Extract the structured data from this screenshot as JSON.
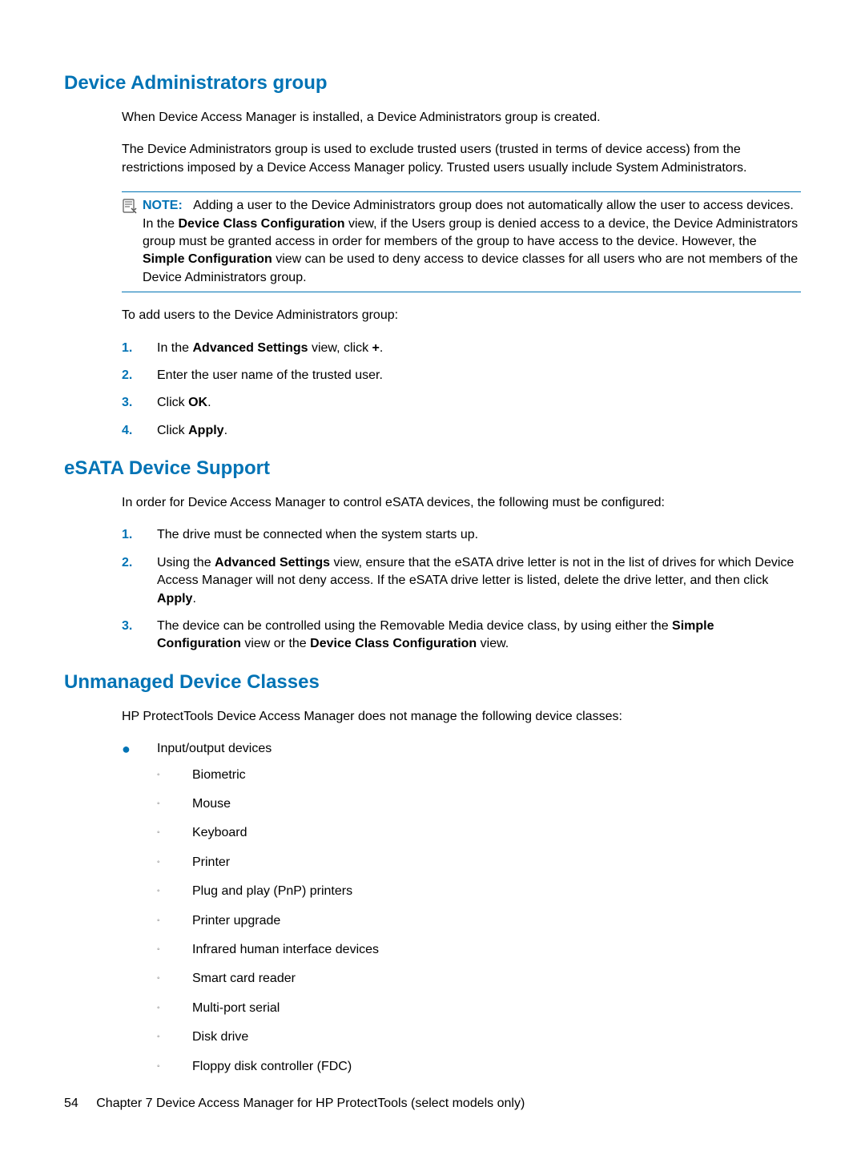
{
  "section1": {
    "heading": "Device Administrators group",
    "p1": "When Device Access Manager is installed, a Device Administrators group is created.",
    "p2": "The Device Administrators group is used to exclude trusted users (trusted in terms of device access) from the restrictions imposed by a Device Access Manager policy. Trusted users usually include System Administrators.",
    "note": {
      "label": "NOTE:",
      "t1": "Adding a user to the Device Administrators group does not automatically allow the user to access devices. In the ",
      "b1": "Device Class Configuration",
      "t2": " view, if the Users group is denied access to a device, the Device Administrators group must be granted access in order for members of the group to have access to the device. However, the ",
      "b2": "Simple Configuration",
      "t3": " view can be used to deny access to device classes for all users who are not members of the Device Administrators group."
    },
    "p3": "To add users to the Device Administrators group:",
    "steps": [
      {
        "num": "1.",
        "pre": "In the ",
        "b1": "Advanced Settings",
        "mid": " view, click ",
        "b2": "+",
        "post": "."
      },
      {
        "num": "2.",
        "text": "Enter the user name of the trusted user."
      },
      {
        "num": "3.",
        "pre": "Click ",
        "b1": "OK",
        "post": "."
      },
      {
        "num": "4.",
        "pre": "Click ",
        "b1": "Apply",
        "post": "."
      }
    ]
  },
  "section2": {
    "heading": "eSATA Device Support",
    "p1": "In order for Device Access Manager to control eSATA devices, the following must be configured:",
    "steps": [
      {
        "num": "1.",
        "text": "The drive must be connected when the system starts up."
      },
      {
        "num": "2.",
        "pre": "Using the ",
        "b1": "Advanced Settings",
        "mid": " view, ensure that the eSATA drive letter is not in the list of drives for which Device Access Manager will not deny access. If the eSATA drive letter is listed, delete the drive letter, and then click ",
        "b2": "Apply",
        "post": "."
      },
      {
        "num": "3.",
        "pre": "The device can be controlled using the Removable Media device class, by using either the ",
        "b1": "Simple Configuration",
        "mid": " view or the ",
        "b2": "Device Class Configuration",
        "post": " view."
      }
    ]
  },
  "section3": {
    "heading": "Unmanaged Device Classes",
    "p1": "HP ProtectTools Device Access Manager does not manage the following device classes:",
    "bullet1": "Input/output devices",
    "subitems": [
      "Biometric",
      "Mouse",
      "Keyboard",
      "Printer",
      "Plug and play (PnP) printers",
      "Printer upgrade",
      "Infrared human interface devices",
      "Smart card reader",
      "Multi-port serial",
      "Disk drive",
      "Floppy disk controller (FDC)"
    ]
  },
  "footer": {
    "page_num": "54",
    "chapter": "Chapter 7   Device Access Manager for HP ProtectTools (select models only)"
  }
}
